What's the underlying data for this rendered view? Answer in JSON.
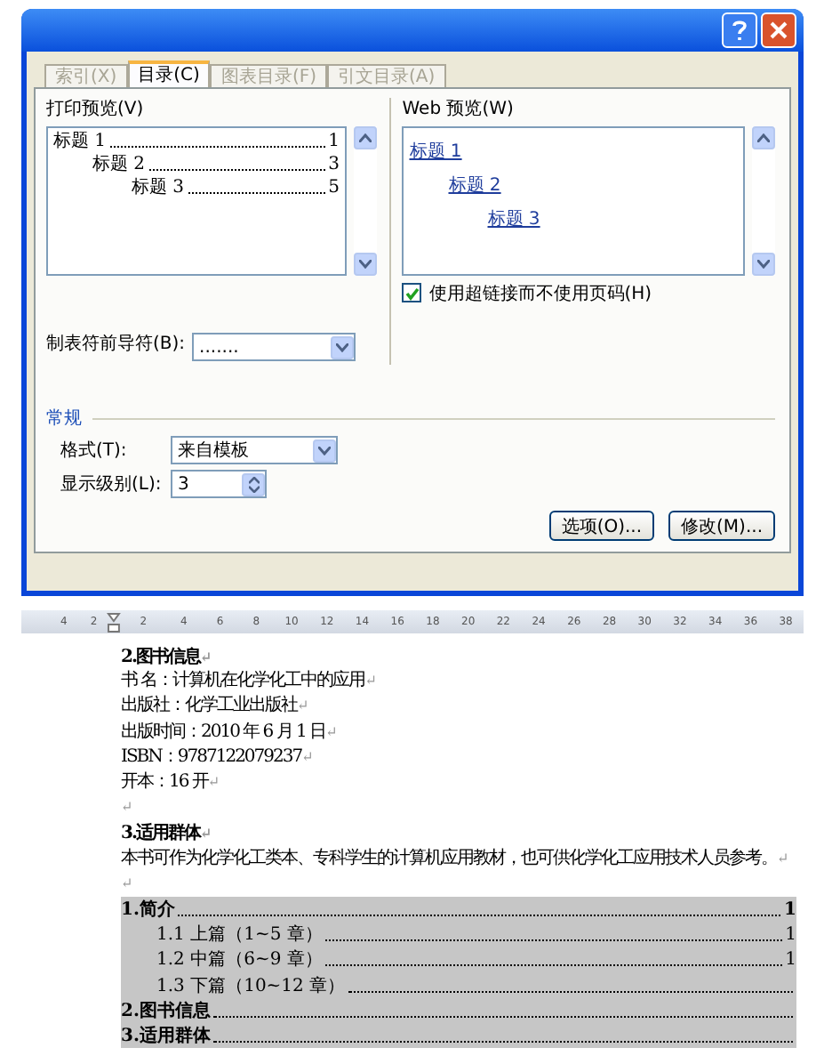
{
  "dialog": {
    "tabs": [
      {
        "label": "索引(X)",
        "selected": false,
        "disabled": true
      },
      {
        "label": "目录(C)",
        "selected": true,
        "disabled": false
      },
      {
        "label": "图表目录(F)",
        "selected": false,
        "disabled": true
      },
      {
        "label": "引文目录(A)",
        "selected": false,
        "disabled": true
      }
    ],
    "print_preview": {
      "label": "打印预览(V)",
      "entries": [
        {
          "text": "标题 1",
          "page": "1",
          "children": [
            {
              "text": "标题 2",
              "page": "3",
              "children": [
                {
                  "text": "标题 3",
                  "page": "5"
                }
              ]
            }
          ]
        }
      ]
    },
    "web_preview": {
      "label": "Web 预览(W)",
      "entries": [
        {
          "text": "标题 1",
          "children": [
            {
              "text": "标题 2",
              "children": [
                {
                  "text": "标题 3"
                }
              ]
            }
          ]
        }
      ]
    },
    "hyperlink_option": {
      "label": "使用超链接而不使用页码(H)",
      "checked": true
    },
    "tab_leader": {
      "label": "制表符前导符(B):",
      "value": "......."
    },
    "general": {
      "title": "常规",
      "format": {
        "label": "格式(T):",
        "value": "来自模板"
      },
      "levels": {
        "label": "显示级别(L):",
        "value": "3"
      }
    },
    "buttons": [
      "选项(O)...",
      "修改(M)..."
    ]
  },
  "ruler": {
    "ticks": [
      "4",
      "2",
      "2",
      "4",
      "6",
      "8",
      "10",
      "12",
      "14",
      "16",
      "18",
      "20",
      "22",
      "24",
      "26",
      "28",
      "30",
      "32",
      "34",
      "36",
      "38"
    ]
  },
  "document": {
    "paragraphs": [
      {
        "kind": "heading",
        "text": "2.图书信息",
        "mark": "↵"
      },
      {
        "kind": "body",
        "text": "书 名：计算机在化学化工中的应用",
        "mark": "↵"
      },
      {
        "kind": "body",
        "text": "出版社：化学工业出版社",
        "mark": "↵"
      },
      {
        "kind": "body",
        "text": "出版时间：2010 年 6 月 1 日",
        "mark": "↵"
      },
      {
        "kind": "body",
        "text": "ISBN：9787122079237",
        "mark": "↵"
      },
      {
        "kind": "body",
        "text": "开本：16 开",
        "mark": "↵"
      },
      {
        "kind": "blank",
        "mark": "↵"
      },
      {
        "kind": "heading",
        "text": "3.适用群体",
        "mark": "↵"
      },
      {
        "kind": "body",
        "text": "本书可作为化学化工类本、专科学生的计算机应用教材，也可供化学化工应用技术人员参考。",
        "mark": "↵"
      },
      {
        "kind": "blank",
        "mark": "↵"
      }
    ],
    "toc": [
      {
        "text": "1.简介",
        "page": "1",
        "children": [
          {
            "text": "1.1 上篇（1~5 章）",
            "page": "1"
          },
          {
            "text": "1.2 中篇（6~9 章）",
            "page": "1"
          },
          {
            "text": "1.3 下篇（10~12 章）"
          }
        ]
      },
      {
        "text": "2.图书信息"
      },
      {
        "text": "3.适用群体"
      }
    ]
  }
}
